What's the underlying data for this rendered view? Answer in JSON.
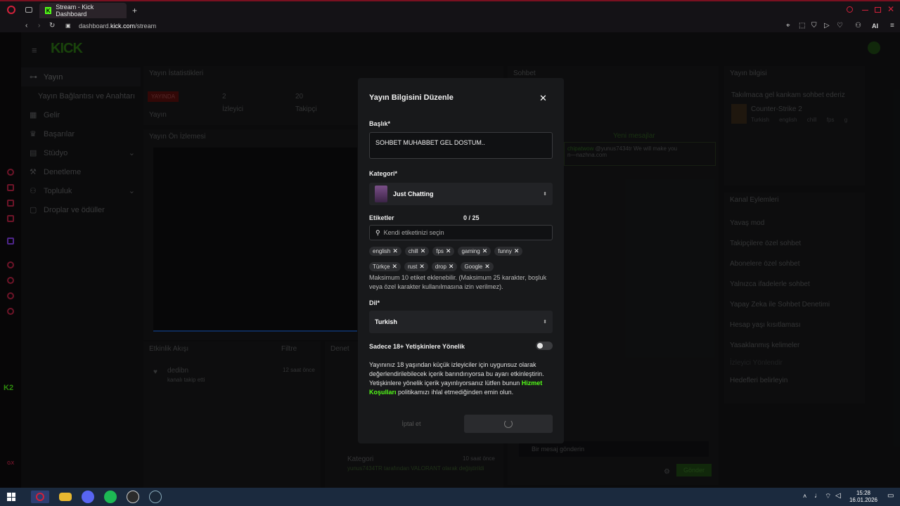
{
  "browser": {
    "tab_title": "Stream - Kick Dashboard",
    "url_prefix": "dashboard.",
    "url_host": "kick.com",
    "url_path": "/stream",
    "ai_label": "AI"
  },
  "sidebar": {
    "items": [
      {
        "label": "Yayın",
        "icon": "broadcast-icon"
      },
      {
        "label": "Yayın Bağlantısı ve Anahtarı",
        "icon": ""
      },
      {
        "label": "Gelir",
        "icon": "money-icon"
      },
      {
        "label": "Başarılar",
        "icon": "trophy-icon"
      },
      {
        "label": "Stüdyo",
        "icon": "studio-icon"
      },
      {
        "label": "Denetleme",
        "icon": "moderation-icon"
      },
      {
        "label": "Topluluk",
        "icon": "community-icon"
      },
      {
        "label": "Droplar ve ödüller",
        "icon": "gift-icon"
      }
    ]
  },
  "panels": {
    "stats_title": "Yayın İstatistikleri",
    "live_badge": "YAYINDA",
    "live_label": "Yayın",
    "viewers_count": "2",
    "viewers_label": "İzleyici",
    "followers_count": "20",
    "followers_label": "Takipçi",
    "preview_title": "Yayın Ön İzlemesi",
    "activity_title": "Etkinlik Akışı",
    "activity_filter": "Filtre",
    "activity_user": "dedibn",
    "activity_time": "12 saat önce",
    "activity_text": "kanalı takip etti",
    "audit_title": "Denet",
    "audit_category_label": "Kategori",
    "audit_category_time": "10 saat önce",
    "audit_category_text": "yunus7434TR tarafından VALORANT olarak değiştirildi",
    "chat_title": "Sohbet",
    "chat_new_messages": "Yeni mesajlar",
    "chat_message_user": "chipatwow",
    "chat_message_text": "@yunus7434tr We will make you",
    "chat_message_text2": "n—nazhna.com",
    "chat_input_placeholder": "Bir mesaj gönderin",
    "chat_send": "Gönder",
    "info_title": "Yayın bilgisi",
    "info_stream_title": "Takılmaca gel kankam sohbet ederiz",
    "info_category": "Counter-Strike 2",
    "info_tags": [
      "Turkish",
      "english",
      "chill",
      "fps",
      "g"
    ],
    "actions_title": "Kanal Eylemleri",
    "actions": [
      "Yavaş mod",
      "Takipçilere özel sohbet",
      "Abonelere özel sohbet",
      "Yalnızca ifadelerle sohbet",
      "Yapay Zeka ile Sohbet Denetimi",
      "Hesap yaşı kısıtlaması",
      "Yasaklanmış kelimeler",
      "İzleyici Yönlendir",
      "Hedefleri belirleyin"
    ]
  },
  "modal": {
    "title": "Yayın Bilgisini Düzenle",
    "title_label": "Başlık*",
    "title_value": "SOHBET MUHABBET GEL DOSTUM..",
    "category_label": "Kategori*",
    "category_value": "Just Chatting",
    "tags_label": "Etiketler",
    "tags_count": "0 / 25",
    "tags_placeholder": "Kendi etiketinizi seçin",
    "tags": [
      "english",
      "chill",
      "fps",
      "gaming",
      "funny",
      "Türkçe",
      "rust",
      "drop",
      "Google"
    ],
    "tags_help": "Maksimum 10 etiket eklenebilir. (Maksimum 25 karakter, boşluk veya özel karakter kullanılmasına izin verilmez).",
    "language_label": "Dil*",
    "language_value": "Turkish",
    "adult_label": "Sadece 18+ Yetişkinlere Yönelik",
    "adult_enabled": false,
    "adult_help_1": "Yayınınız 18 yaşından küçük izleyiciler için uygunsuz olarak değerlendirilebilecek içerik barındırıyorsa bu ayarı etkinleştirin. Yetişkinlere yönelik içerik yayınlıyorsanız lütfen bunun ",
    "adult_help_link": "Hizmet Koşulları",
    "adult_help_2": " politikamızı ihlal etmediğinden emin olun.",
    "cancel_label": "İptal et"
  },
  "taskbar": {
    "time": "15:28",
    "date": "16.01.2026"
  },
  "colors": {
    "accent": "#53fc18",
    "live": "#e91916",
    "bg": "#141517"
  }
}
